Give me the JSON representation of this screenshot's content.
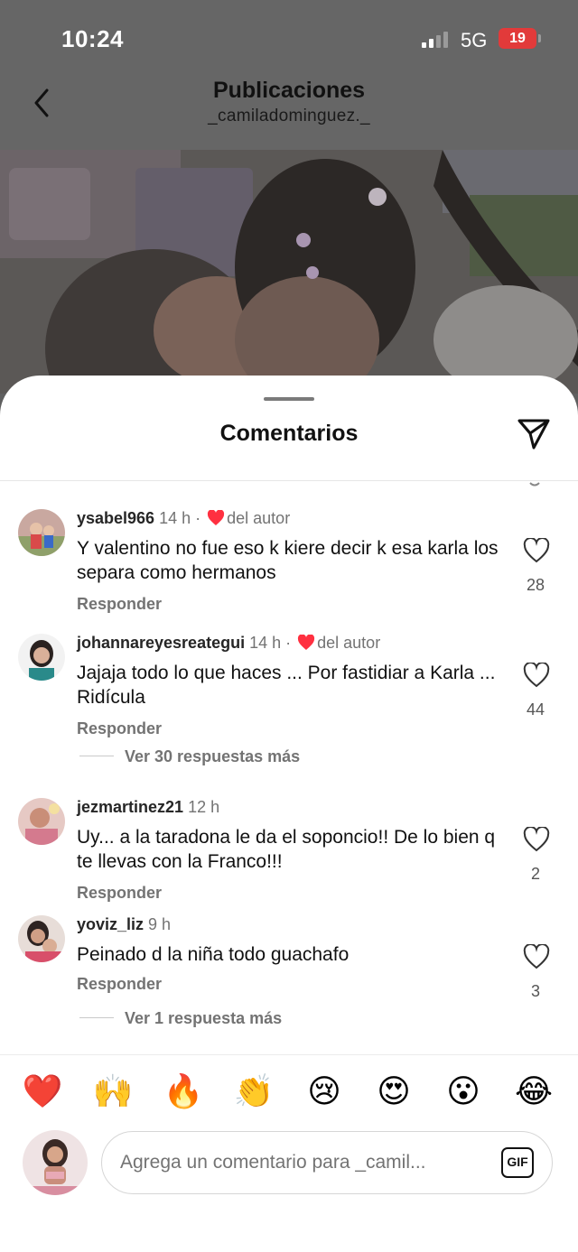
{
  "status": {
    "time": "10:24",
    "network": "5G",
    "battery": "19"
  },
  "nav": {
    "title": "Publicaciones",
    "username": "_camiladominguez._"
  },
  "sheet": {
    "title": "Comentarios"
  },
  "comments": [
    {
      "user": "ysabel966",
      "time": "14 h",
      "author_like": "del autor",
      "text": "Y valentino no fue eso k kiere decir k esa karla los separa como hermanos",
      "reply": "Responder",
      "likes": "28",
      "more_replies": ""
    },
    {
      "user": "johannareyesreategui",
      "time": "14 h",
      "author_like": "del autor",
      "text": "Jajaja todo lo que haces ... Por fastidiar a Karla ... Ridícula",
      "reply": "Responder",
      "likes": "44",
      "more_replies": "Ver 30 respuestas más"
    },
    {
      "user": "jezmartinez21",
      "time": "12 h",
      "author_like": "",
      "text": "Uy... a la taradona le da el soponcio!! De lo bien q te llevas con la Franco!!!",
      "reply": "Responder",
      "likes": "2",
      "more_replies": ""
    },
    {
      "user": "yoviz_liz",
      "time": "9 h",
      "author_like": "",
      "text": "Peinado d la niña todo guachafo",
      "reply": "Responder",
      "likes": "3",
      "more_replies": "Ver 1 respuesta más"
    }
  ],
  "reactions": [
    "❤️",
    "🙌",
    "🔥",
    "👏",
    "😢",
    "😍",
    "😮",
    "😂"
  ],
  "composer": {
    "placeholder": "Agrega un comentario para _camil...",
    "gif_label": "GIF"
  },
  "colors": {
    "heart_red": "#ff3040",
    "battery_red": "#e23a3a",
    "secondary_text": "#737373"
  }
}
